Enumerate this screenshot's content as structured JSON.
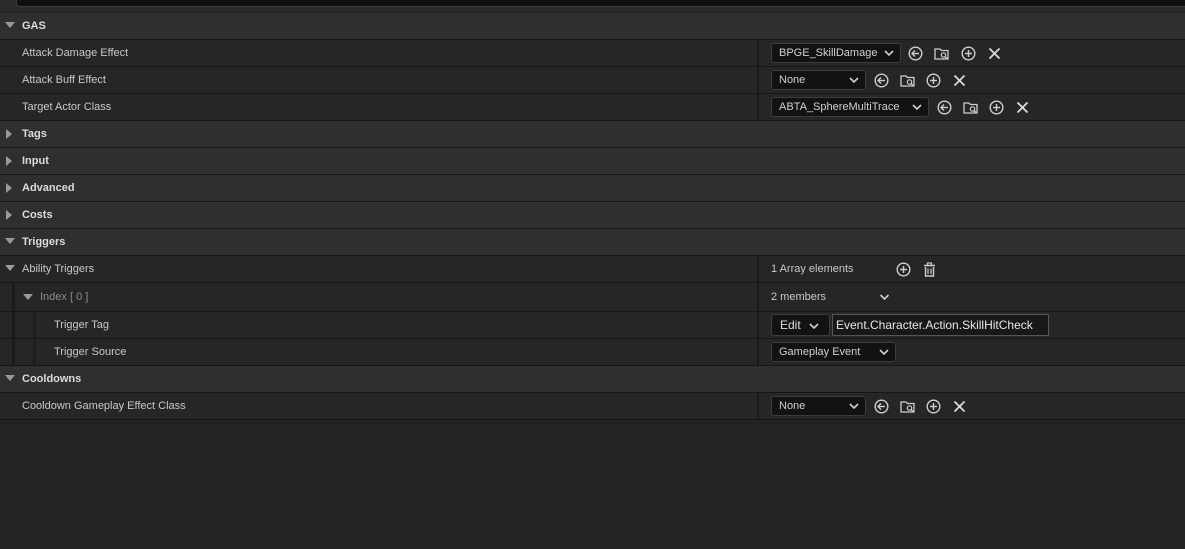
{
  "categories": {
    "gas": "GAS",
    "tags": "Tags",
    "input": "Input",
    "advanced": "Advanced",
    "costs": "Costs",
    "triggers": "Triggers",
    "cooldowns": "Cooldowns"
  },
  "props": {
    "attack_damage": {
      "label": "Attack Damage Effect",
      "value": "BPGE_SkillDamage"
    },
    "attack_buff": {
      "label": "Attack Buff Effect",
      "value": "None"
    },
    "target_actor": {
      "label": "Target Actor Class",
      "value": "ABTA_SphereMultiTrace"
    },
    "ability_triggers": {
      "label": "Ability Triggers",
      "value": "1 Array elements"
    },
    "index0": {
      "label": "Index [ 0 ]",
      "value": "2 members"
    },
    "trigger_tag": {
      "label": "Trigger Tag",
      "edit": "Edit",
      "value": "Event.Character.Action.SkillHitCheck"
    },
    "trigger_source": {
      "label": "Trigger Source",
      "value": "Gameplay Event"
    },
    "cooldown": {
      "label": "Cooldown Gameplay Effect Class",
      "value": "None"
    }
  },
  "icons": {
    "use_selected": "arrow-left-circle-icon",
    "browse": "folder-search-icon",
    "add": "plus-circle-icon",
    "clear": "close-icon",
    "delete": "trash-icon",
    "expand": "chevron-down-icon",
    "search": "search-icon"
  },
  "colors": {
    "background": "#232323",
    "category_row": "#2f2f2f",
    "property_row": "#262626",
    "field_bg": "#121212"
  }
}
